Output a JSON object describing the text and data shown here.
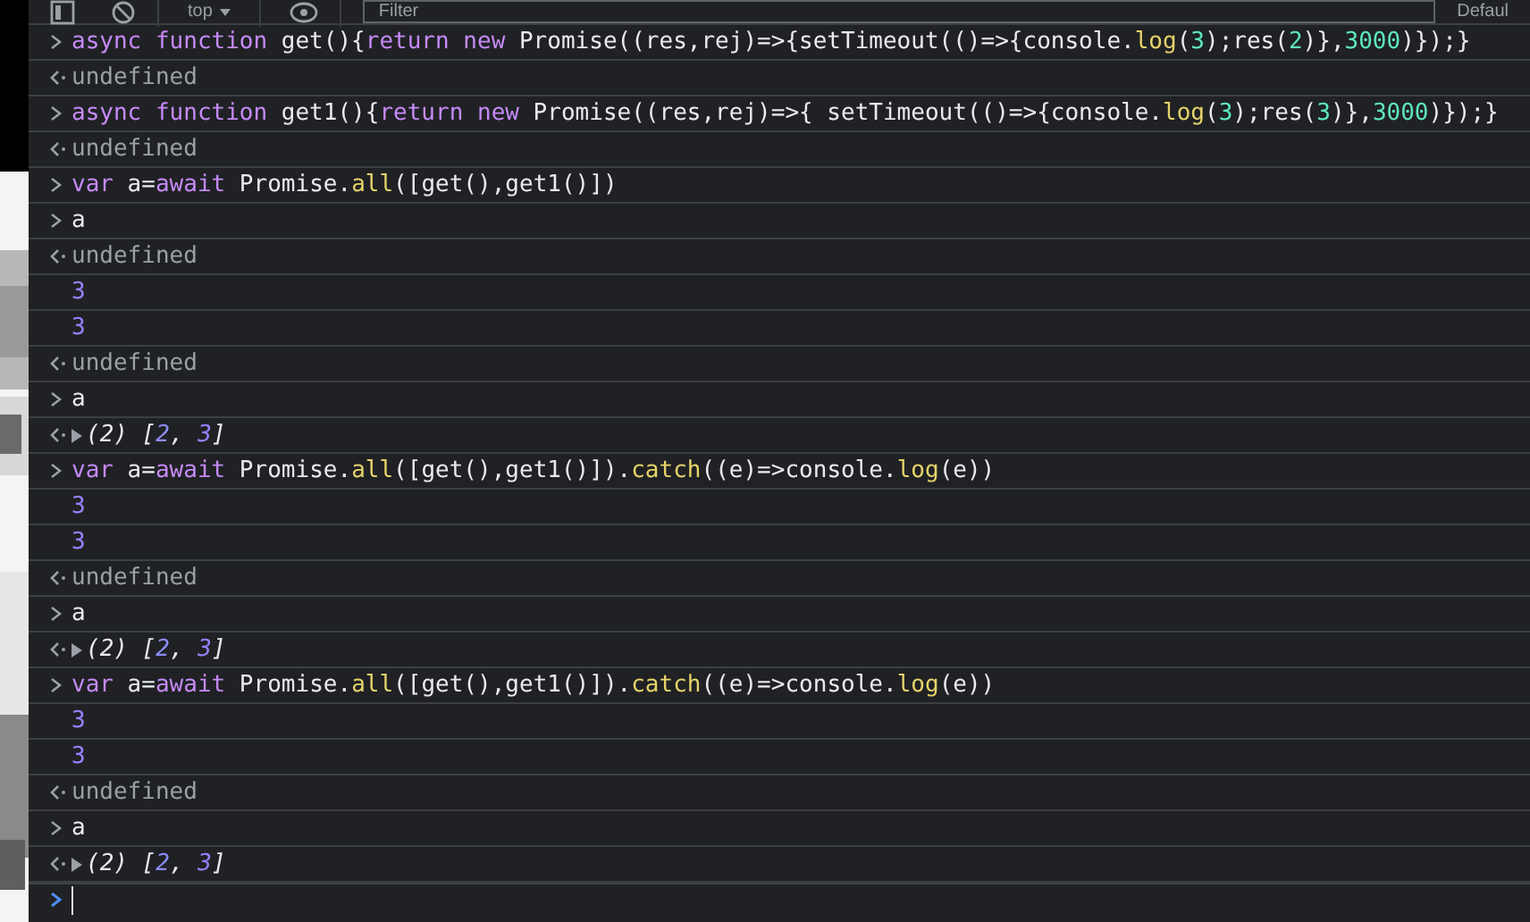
{
  "toolbar": {
    "context": "top",
    "filter_placeholder": "Filter",
    "levels": "Defaul"
  },
  "console": [
    {
      "kind": "input",
      "tokens": [
        {
          "kind": "keyword",
          "text": "async function"
        },
        {
          "kind": "plain",
          "text": " get(){"
        },
        {
          "kind": "keyword",
          "text": "return new"
        },
        {
          "kind": "plain",
          "text": " Promise((res,rej)=>{setTimeout(()=>{console."
        },
        {
          "kind": "method",
          "text": "log"
        },
        {
          "kind": "plain",
          "text": "("
        },
        {
          "kind": "number",
          "text": "3"
        },
        {
          "kind": "plain",
          "text": ");res("
        },
        {
          "kind": "number",
          "text": "2"
        },
        {
          "kind": "plain",
          "text": ")},"
        },
        {
          "kind": "number",
          "text": "3000"
        },
        {
          "kind": "plain",
          "text": ")});}"
        }
      ]
    },
    {
      "kind": "result",
      "tokens": [
        {
          "kind": "muted",
          "text": "undefined"
        }
      ]
    },
    {
      "kind": "input",
      "tokens": [
        {
          "kind": "keyword",
          "text": "async function"
        },
        {
          "kind": "plain",
          "text": " get1(){"
        },
        {
          "kind": "keyword",
          "text": "return new"
        },
        {
          "kind": "plain",
          "text": " Promise((res,rej)=>{ setTimeout(()=>{console."
        },
        {
          "kind": "method",
          "text": "log"
        },
        {
          "kind": "plain",
          "text": "("
        },
        {
          "kind": "number",
          "text": "3"
        },
        {
          "kind": "plain",
          "text": ");res("
        },
        {
          "kind": "number",
          "text": "3"
        },
        {
          "kind": "plain",
          "text": ")},"
        },
        {
          "kind": "number",
          "text": "3000"
        },
        {
          "kind": "plain",
          "text": ")});}"
        }
      ]
    },
    {
      "kind": "result",
      "tokens": [
        {
          "kind": "muted",
          "text": "undefined"
        }
      ]
    },
    {
      "kind": "input",
      "tokens": [
        {
          "kind": "keyword",
          "text": "var"
        },
        {
          "kind": "plain",
          "text": " a="
        },
        {
          "kind": "keyword",
          "text": "await"
        },
        {
          "kind": "plain",
          "text": " Promise."
        },
        {
          "kind": "method",
          "text": "all"
        },
        {
          "kind": "plain",
          "text": "([get(),get1()])"
        }
      ]
    },
    {
      "kind": "input",
      "tokens": [
        {
          "kind": "plain",
          "text": "a"
        }
      ]
    },
    {
      "kind": "result",
      "tokens": [
        {
          "kind": "muted",
          "text": "undefined"
        }
      ]
    },
    {
      "kind": "log",
      "tokens": [
        {
          "kind": "value",
          "text": "3"
        }
      ]
    },
    {
      "kind": "log",
      "tokens": [
        {
          "kind": "value",
          "text": "3"
        }
      ]
    },
    {
      "kind": "result",
      "tokens": [
        {
          "kind": "muted",
          "text": "undefined"
        }
      ]
    },
    {
      "kind": "input",
      "tokens": [
        {
          "kind": "plain",
          "text": "a"
        }
      ]
    },
    {
      "kind": "object",
      "expanded": false,
      "tokens": [
        {
          "kind": "plain",
          "text": "(2) ["
        },
        {
          "kind": "index",
          "text": "2"
        },
        {
          "kind": "plain",
          "text": ", "
        },
        {
          "kind": "value",
          "text": "3"
        },
        {
          "kind": "plain",
          "text": "]"
        }
      ]
    },
    {
      "kind": "input",
      "tokens": [
        {
          "kind": "keyword",
          "text": "var"
        },
        {
          "kind": "plain",
          "text": " a="
        },
        {
          "kind": "keyword",
          "text": "await"
        },
        {
          "kind": "plain",
          "text": " Promise."
        },
        {
          "kind": "method",
          "text": "all"
        },
        {
          "kind": "plain",
          "text": "([get(),get1()])."
        },
        {
          "kind": "method",
          "text": "catch"
        },
        {
          "kind": "plain",
          "text": "((e)=>console."
        },
        {
          "kind": "method",
          "text": "log"
        },
        {
          "kind": "plain",
          "text": "(e))"
        }
      ]
    },
    {
      "kind": "log",
      "tokens": [
        {
          "kind": "value",
          "text": "3"
        }
      ]
    },
    {
      "kind": "log",
      "tokens": [
        {
          "kind": "value",
          "text": "3"
        }
      ]
    },
    {
      "kind": "result",
      "tokens": [
        {
          "kind": "muted",
          "text": "undefined"
        }
      ]
    },
    {
      "kind": "input",
      "tokens": [
        {
          "kind": "plain",
          "text": "a"
        }
      ]
    },
    {
      "kind": "object",
      "expanded": false,
      "tokens": [
        {
          "kind": "plain",
          "text": "(2) ["
        },
        {
          "kind": "index",
          "text": "2"
        },
        {
          "kind": "plain",
          "text": ", "
        },
        {
          "kind": "value",
          "text": "3"
        },
        {
          "kind": "plain",
          "text": "]"
        }
      ]
    },
    {
      "kind": "input",
      "tokens": [
        {
          "kind": "keyword",
          "text": "var"
        },
        {
          "kind": "plain",
          "text": " a="
        },
        {
          "kind": "keyword",
          "text": "await"
        },
        {
          "kind": "plain",
          "text": " Promise."
        },
        {
          "kind": "method",
          "text": "all"
        },
        {
          "kind": "plain",
          "text": "([get(),get1()])."
        },
        {
          "kind": "method",
          "text": "catch"
        },
        {
          "kind": "plain",
          "text": "((e)=>console."
        },
        {
          "kind": "method",
          "text": "log"
        },
        {
          "kind": "plain",
          "text": "(e))"
        }
      ]
    },
    {
      "kind": "log",
      "tokens": [
        {
          "kind": "value",
          "text": "3"
        }
      ]
    },
    {
      "kind": "log",
      "tokens": [
        {
          "kind": "value",
          "text": "3"
        }
      ]
    },
    {
      "kind": "result",
      "tokens": [
        {
          "kind": "muted",
          "text": "undefined"
        }
      ]
    },
    {
      "kind": "input",
      "tokens": [
        {
          "kind": "plain",
          "text": "a"
        }
      ]
    },
    {
      "kind": "object",
      "expanded": false,
      "tokens": [
        {
          "kind": "plain",
          "text": "(2) ["
        },
        {
          "kind": "index",
          "text": "2"
        },
        {
          "kind": "plain",
          "text": ", "
        },
        {
          "kind": "value",
          "text": "3"
        },
        {
          "kind": "plain",
          "text": "]"
        }
      ]
    }
  ]
}
